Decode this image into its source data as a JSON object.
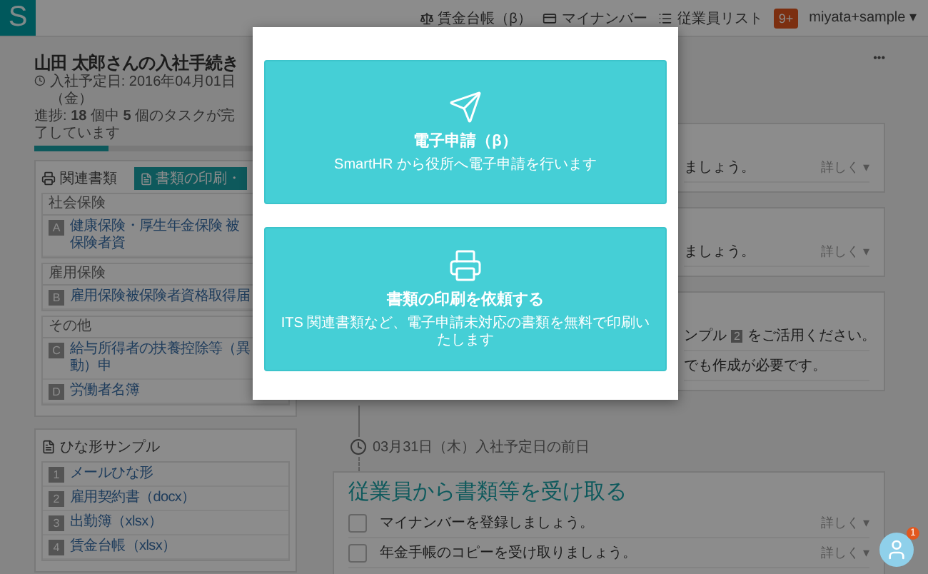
{
  "header": {
    "logo": "S",
    "nav": [
      {
        "kind": "ledger",
        "label": "賃金台帳（β）"
      },
      {
        "kind": "card",
        "label": "マイナンバー"
      },
      {
        "kind": "list",
        "label": "従業員リスト"
      }
    ],
    "notification_count": "9+",
    "user": "miyata+sample ▾"
  },
  "page": {
    "title": "山田 太郎さんの入社手続き",
    "date": "入社予定日: 2016年04月01日（金）",
    "progress_text": "進捗: **18** 個中 **5** 個のタスクが完了しています",
    "progress": {
      "level": 0.28
    },
    "menu": "•••"
  },
  "documents": {
    "title": "関連書類",
    "print_button": "書類の印刷・",
    "sections": [
      {
        "label": "社会保険",
        "items": [
          {
            "badge": "A",
            "label": "健康保険・厚生年金保険 被保険者資"
          }
        ]
      },
      {
        "label": "雇用保険",
        "items": [
          {
            "badge": "B",
            "label": "雇用保険被保険者資格取得届"
          }
        ]
      },
      {
        "label": "その他",
        "items": [
          {
            "badge": "C",
            "label": "給与所得者の扶養控除等（異動）申"
          },
          {
            "badge": "D",
            "label": "労働者名簿"
          }
        ]
      }
    ]
  },
  "templates": {
    "title": "ひな形サンプル",
    "items": [
      {
        "badge": "1",
        "label": "メールひな形"
      },
      {
        "badge": "2",
        "label": "雇用契約書（docx）"
      },
      {
        "badge": "3",
        "label": "出勤簿（xlsx）"
      },
      {
        "badge": "4",
        "label": "賃金台帳（xlsx）"
      }
    ]
  },
  "task_cards": [
    {
      "rows": [
        {
          "text": "ましょう。",
          "more": "詳しく ▾"
        }
      ]
    },
    {
      "rows": [
        {
          "text": "ましょう。",
          "more": "詳しく ▾"
        }
      ]
    },
    {
      "rows": [
        {
          "text": "ンプル",
          "badge": "2",
          "text_after": "をご活用ください。"
        },
        {
          "text": "でも作成が必要です。"
        }
      ]
    }
  ],
  "milestone": {
    "text": "03月31日（木）入社予定日の前日"
  },
  "section": {
    "title": "従業員から書類等を受け取る",
    "tasks": [
      {
        "text": "マイナンバーを登録しましょう。",
        "checked": false,
        "more": "詳しく ▾"
      },
      {
        "text": "年金手帳のコピーを受け取りましょう。",
        "checked": false,
        "more": "詳しく ▾"
      }
    ]
  },
  "modal": {
    "options": [
      {
        "kind": "electronic",
        "title": "電子申請（β）",
        "description": "SmartHR から役所へ電子申請を行います"
      },
      {
        "kind": "print",
        "title": "書類の印刷を依頼する",
        "description": "ITS 関連書類など、電子申請未対応の書類を無料で印刷いたします"
      }
    ]
  },
  "chat": {
    "badge": "1"
  }
}
